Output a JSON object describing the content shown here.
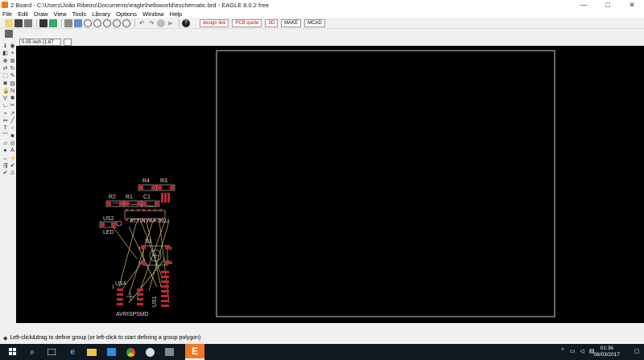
{
  "window": {
    "title": "2 Board - C:\\Users\\João Ribeiro\\Documents\\eagle\\helloworld\\eschematic.brd - EAGLE 8.0.2 free",
    "minimize_glyph": "—",
    "maximize_glyph": "□",
    "close_glyph": "✕"
  },
  "menu": [
    "File",
    "Edit",
    "Draw",
    "View",
    "Tools",
    "Library",
    "Options",
    "Window",
    "Help"
  ],
  "toolbar": {
    "buttons": [
      "open-icon",
      "save-icon",
      "print-icon",
      "cam-icon",
      "board-icon",
      "grid-icon",
      "layers-icon",
      "zoom-fit-icon",
      "zoom-in-icon",
      "zoom-out-icon",
      "zoom-select-icon",
      "zoom-redraw-icon",
      "undo-icon",
      "redo-icon",
      "stop-icon",
      "go-icon",
      "help-icon"
    ],
    "ext_buttons": [
      {
        "name": "design-link-button",
        "label": "design link"
      },
      {
        "name": "pcb-quote-button",
        "label": "PCB quote"
      },
      {
        "name": "fusion-button",
        "label": "3D"
      },
      {
        "name": "make-button",
        "label": "MAKE"
      },
      {
        "name": "mcad-button",
        "label": "MCAD"
      }
    ]
  },
  "coord": {
    "value": "0.05 inch (1.67 1.89)"
  },
  "canvas": {
    "components": [
      {
        "label": "R4"
      },
      {
        "label": "R3"
      },
      {
        "label": "R2"
      },
      {
        "label": "R1"
      },
      {
        "label": "C1"
      },
      {
        "label": "US2"
      },
      {
        "label": "LED"
      },
      {
        "label": "ATTINY44-SSU"
      },
      {
        "label": "S1"
      },
      {
        "label": "US4"
      },
      {
        "label": "US1"
      },
      {
        "label": "AVRISPSMD"
      }
    ],
    "labels": {
      "r4": "R4",
      "r3": "R3",
      "r2": "R2",
      "r1": "R1",
      "c1": "C1",
      "us2": "US2",
      "led": "LED",
      "attiny": "ATTINY44-SSU",
      "s1": "S1",
      "us4": "US4",
      "us1": "US1",
      "avr": "AVRISPSMD",
      "pin1": "1",
      "pin2": "2",
      "pin3": "3",
      "pin4": "4",
      "one": "1"
    },
    "colors": {
      "board_outline": "#c8c8c8",
      "pad": "#c0282c",
      "silk": "#d8d8d8",
      "airwire": "#e6d27a"
    }
  },
  "status": {
    "text": "Left-click&drag to define group (or left-click to start defining a group polygon)"
  },
  "taskbar": {
    "time": "01:36",
    "date": "08/03/2017",
    "apps": [
      "windows-start-icon",
      "search-icon",
      "task-view-icon",
      "edge-icon",
      "file-explorer-icon",
      "store-icon",
      "chrome-icon",
      "github-icon",
      "app-icon",
      "eagle-icon"
    ]
  }
}
